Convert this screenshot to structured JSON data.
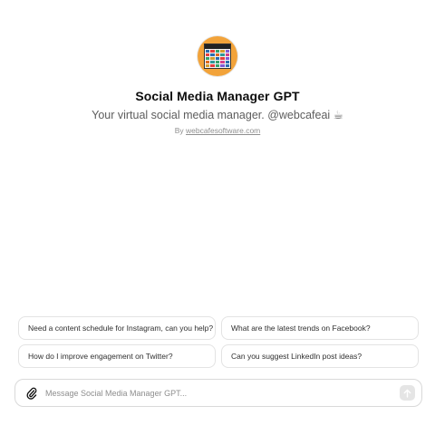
{
  "gpt": {
    "avatar_icon": "calendar-collage-icon",
    "avatar_colors": {
      "ring": "#f2a33a",
      "cells": [
        "#2b6cb0",
        "#e53e3e",
        "#38a169",
        "#d69e2e",
        "#805ad5",
        "#e53e3e",
        "#2b6cb0",
        "#dd6b20",
        "#319795",
        "#d53f8c",
        "#38a169",
        "#d69e2e",
        "#2b6cb0",
        "#e53e3e",
        "#805ad5",
        "#dd6b20",
        "#319795",
        "#38a169",
        "#d53f8c",
        "#2b6cb0",
        "#d69e2e",
        "#e53e3e",
        "#38a169",
        "#805ad5",
        "#2b6cb0"
      ]
    },
    "name": "Social Media Manager GPT",
    "description": "Your virtual social media manager. @webcafeai ☕",
    "byline_prefix": "By",
    "byline_link": "webcafesoftware.com"
  },
  "suggestions": [
    "Need a content schedule for Instagram, can you help?",
    "What are the latest trends on Facebook?",
    "How do I improve engagement on Twitter?",
    "Can you suggest LinkedIn post ideas?"
  ],
  "composer": {
    "attach_icon": "paperclip-icon",
    "placeholder": "Message Social Media Manager GPT...",
    "value": "",
    "send_icon": "arrow-up-icon",
    "send_enabled": false
  }
}
